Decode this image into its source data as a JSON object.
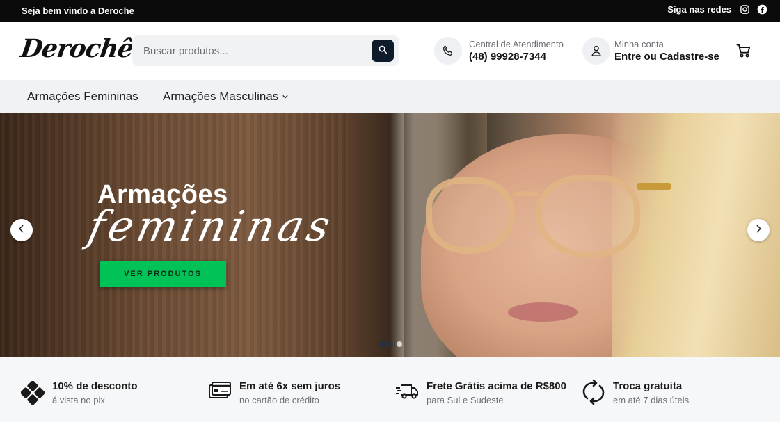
{
  "topbar": {
    "welcome": "Seja bem vindo a Deroche",
    "social_label": "Siga nas redes",
    "social_icons": [
      "instagram-icon",
      "facebook-icon"
    ]
  },
  "header": {
    "logo_text": "Derochê",
    "search": {
      "placeholder": "Buscar produtos..."
    },
    "support": {
      "label": "Central de Atendimento",
      "phone": "(48) 99928-7344"
    },
    "account": {
      "label": "Minha conta",
      "action": "Entre ou Cadastre-se"
    }
  },
  "nav": {
    "items": [
      {
        "label": "Armações Femininas"
      },
      {
        "label": "Armações Masculinas"
      }
    ]
  },
  "hero": {
    "title_line1": "Armações",
    "title_line2": "femininas",
    "cta_label": "VER PRODUTOS",
    "slide_count": 2,
    "active_slide": 1
  },
  "benefits": [
    {
      "title": "10% de desconto",
      "subtitle": "á vista no pix",
      "icon": "pix-icon"
    },
    {
      "title": "Em até 6x sem juros",
      "subtitle": "no cartão de crédito",
      "icon": "credit-card-icon"
    },
    {
      "title": "Frete Grátis acima de R$800",
      "subtitle": "para Sul e Sudeste",
      "icon": "delivery-truck-icon"
    },
    {
      "title": "Troca gratuita",
      "subtitle": "em até 7 dias úteis",
      "icon": "exchange-icon"
    }
  ],
  "colors": {
    "topbar_bg": "#0a0a0a",
    "search_button": "#0d1b2a",
    "cta_green": "#00c257",
    "nav_bg": "#f1f2f4"
  }
}
